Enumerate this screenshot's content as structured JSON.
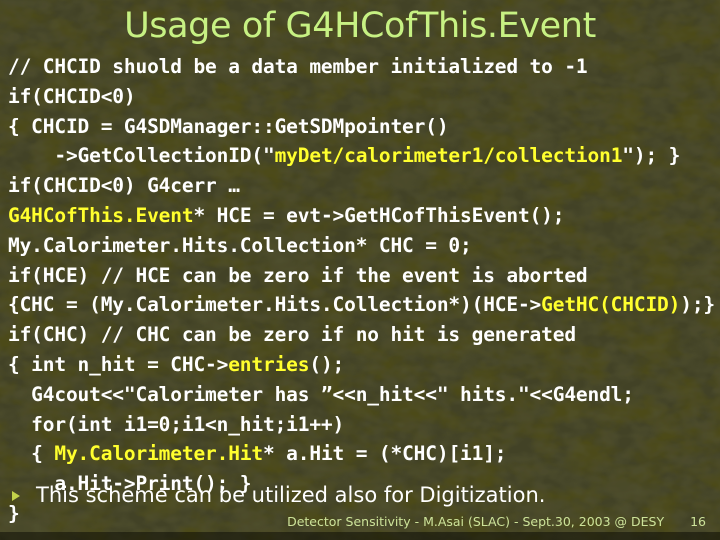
{
  "slide": {
    "title": "Usage of G4HCof This.Event",
    "title_display": "Usage of G4HCofThis.Event",
    "background_color": "#4c4a18",
    "title_color": "#c7f183",
    "code_color": "#ffffff",
    "highlight_color": "#ffff2e",
    "footer_color": "#cde39a"
  },
  "code": {
    "lines": [
      {
        "segments": [
          {
            "text": "// CHCID shuold be a data member initialized to -1",
            "highlight": false
          }
        ]
      },
      {
        "segments": [
          {
            "text": "if(CHCID<0)",
            "highlight": false
          }
        ]
      },
      {
        "segments": [
          {
            "text": "{ CHCID = G4SDManager::GetSDMpointer()",
            "highlight": false
          }
        ]
      },
      {
        "segments": [
          {
            "text": "    ->GetCollectionID(\"",
            "highlight": false
          },
          {
            "text": "myDet/calorimeter1/collection1",
            "highlight": true
          },
          {
            "text": "\"); }",
            "highlight": false
          }
        ]
      },
      {
        "segments": [
          {
            "text": "if(CHCID<0) G4cerr …",
            "highlight": false
          }
        ]
      },
      {
        "segments": [
          {
            "text": "G4HCofThis.Event",
            "highlight": true
          },
          {
            "text": "* HCE = evt->GetHCofThisEvent();",
            "highlight": false
          }
        ]
      },
      {
        "segments": [
          {
            "text": "My.Calorimeter.Hits.Collection* CHC = 0;",
            "highlight": false
          }
        ]
      },
      {
        "segments": [
          {
            "text": "if(HCE) // HCE can be zero if the event is aborted",
            "highlight": false
          }
        ]
      },
      {
        "segments": [
          {
            "text": "{CHC = (My.Calorimeter.Hits.Collection*)(HCE->",
            "highlight": false
          },
          {
            "text": "GetHC(CHCID)",
            "highlight": true
          },
          {
            "text": ");}",
            "highlight": false
          }
        ]
      },
      {
        "segments": [
          {
            "text": "if(CHC) // CHC can be zero if no hit is generated",
            "highlight": false
          }
        ]
      },
      {
        "segments": [
          {
            "text": "{ int n_hit = CHC->",
            "highlight": false
          },
          {
            "text": "entries",
            "highlight": true
          },
          {
            "text": "();",
            "highlight": false
          }
        ]
      },
      {
        "segments": [
          {
            "text": "  G4cout<<\"Calorimeter has ”<<n_hit<<\" hits.\"<<G4endl;",
            "highlight": false
          }
        ]
      },
      {
        "segments": [
          {
            "text": "  for(int i1=0;i1<n_hit;i1++)",
            "highlight": false
          }
        ]
      },
      {
        "segments": [
          {
            "text": "  { ",
            "highlight": false
          },
          {
            "text": "My.Calorimeter.Hit",
            "highlight": true
          },
          {
            "text": "* a.Hit = (*CHC)[i1];",
            "highlight": false
          }
        ]
      },
      {
        "segments": [
          {
            "text": "    a.Hit->Print(); }",
            "highlight": false
          }
        ]
      },
      {
        "segments": [
          {
            "text": "}",
            "highlight": false
          }
        ]
      }
    ]
  },
  "bullet": {
    "marker": "triangle-bullet-icon",
    "text": "This scheme can be utilized also for Digitization."
  },
  "footer": {
    "text": "Detector Sensitivity - M.Asai (SLAC) - Sept.30, 2003 @ DESY",
    "page": "16"
  }
}
